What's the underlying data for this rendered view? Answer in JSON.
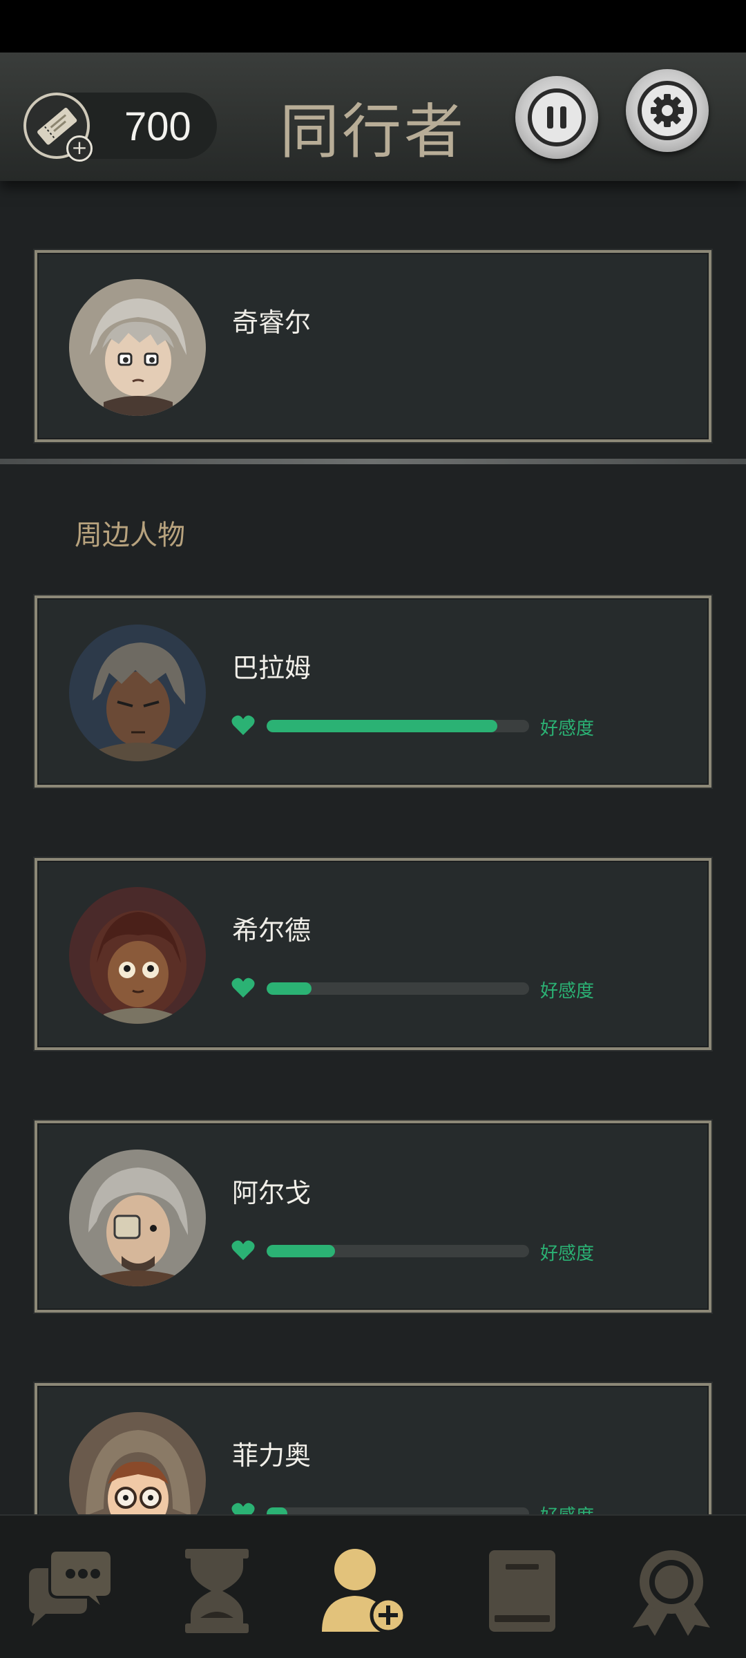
{
  "header": {
    "title": "同行者",
    "currency_amount": "700",
    "icons": {
      "currency": "ticket-add-icon",
      "pause": "pause-icon",
      "settings": "gear-icon"
    }
  },
  "companion": {
    "name": "奇睿尔"
  },
  "section": {
    "title": "周边人物"
  },
  "characters": [
    {
      "name": "巴拉姆",
      "affinity_label": "好感度",
      "affinity": 0.88
    },
    {
      "name": "希尔德",
      "affinity_label": "好感度",
      "affinity": 0.17
    },
    {
      "name": "阿尔戈",
      "affinity_label": "好感度",
      "affinity": 0.26
    },
    {
      "name": "菲力奥",
      "affinity_label": "好感度",
      "affinity": 0.08
    }
  ],
  "bottom_nav": {
    "items": [
      {
        "icon": "chat-bubbles-icon",
        "active": false
      },
      {
        "icon": "hourglass-icon",
        "active": false
      },
      {
        "icon": "add-person-icon",
        "active": true
      },
      {
        "icon": "book-icon",
        "active": false
      },
      {
        "icon": "achievement-badge-icon",
        "active": false
      }
    ]
  },
  "colors": {
    "accent_green": "#2bb274",
    "title_beige": "#b8ad97",
    "section_gold": "#b8a37e",
    "active_nav": "#e2c27b",
    "inactive_nav": "#4f4a40"
  }
}
